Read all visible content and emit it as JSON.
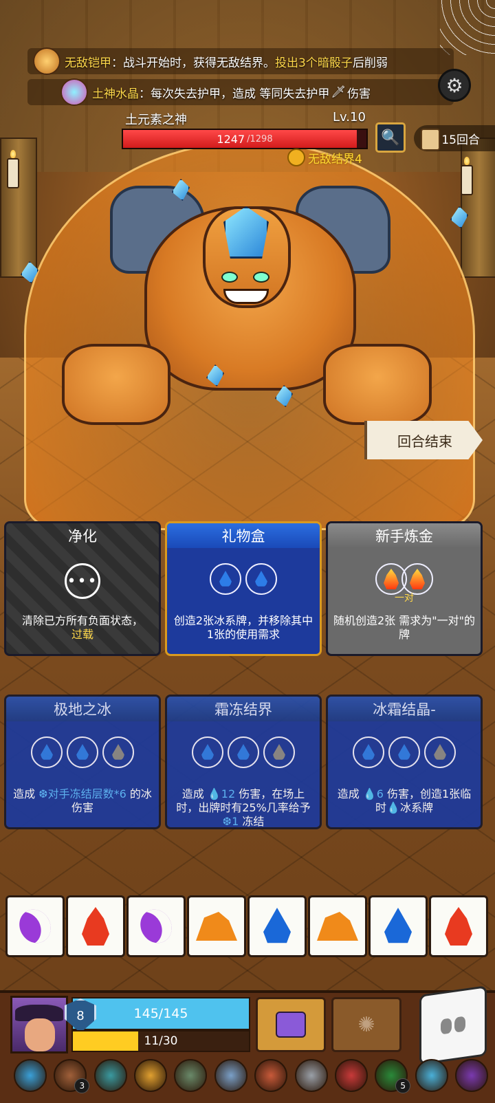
{
  "buffs": [
    {
      "name": "无敌铠甲",
      "sep": "：",
      "text_a": "战斗开始时，获得无敌结界。",
      "highlight": "投出3个暗骰子",
      "text_b": "后削弱",
      "icon": "golden-armor-icon"
    },
    {
      "name": "土神水晶",
      "sep": "：",
      "text_a": "每次失去护甲，造成 等同失去护甲",
      "highlight": "",
      "text_b": "伤害",
      "icon": "crystal-cluster-icon"
    }
  ],
  "boss": {
    "name": "土元素之神",
    "level": "Lv.10",
    "hp_current": "1247",
    "hp_max": "/1298",
    "hp_fraction": 0.96,
    "status": "无敌结界4"
  },
  "round": {
    "label": "15回合"
  },
  "end_turn": {
    "label": "回合结束"
  },
  "cards": [
    {
      "title": "净化",
      "desc_a": "清除已方所有负面状态，",
      "desc_hl": "过载",
      "requirement": "any"
    },
    {
      "title": "礼物盒",
      "desc_a": "创造2张冰系牌，并移除其中1张的使用需求",
      "requirement": "water x2"
    },
    {
      "title": "新手炼金",
      "pair_label": "一对",
      "desc_a": "随机创造2张 需求为\"一对\"的牌",
      "requirement": "fire pair"
    },
    {
      "title": "极地之冰",
      "desc_a": "造成 ",
      "desc_hl": "❆对手冻结层数*6",
      "desc_b": " 的冰伤害",
      "requirement": "water x3"
    },
    {
      "title": "霜冻结界",
      "desc_a": "造成 ",
      "desc_hl": "💧12",
      "desc_b": " 伤害，在场上时，出牌时有25%几率给予",
      "desc_hl2": "❆1",
      "desc_c": " 冻结",
      "requirement": "water x3"
    },
    {
      "title": "冰霜结晶-",
      "desc_a": "造成 ",
      "desc_hl": "💧6",
      "desc_b": " 伤害，创造1张临时",
      "desc_hl2": "💧",
      "desc_c": "冰系牌",
      "requirement": "water x3"
    }
  ],
  "dice": [
    "moon",
    "fire",
    "moon",
    "rock",
    "water",
    "rock",
    "water",
    "fire"
  ],
  "player": {
    "shield": "8",
    "hp": "145/145",
    "xp": "11/30",
    "xp_fraction": 0.37
  },
  "relics": [
    {
      "icon": "blue-mask-relic-icon",
      "count": ""
    },
    {
      "icon": "button-relic-icon",
      "count": "3"
    },
    {
      "icon": "urn-relic-icon",
      "count": ""
    },
    {
      "icon": "bird-relic-icon",
      "count": ""
    },
    {
      "icon": "scythe-relic-icon",
      "count": ""
    },
    {
      "icon": "blade-relic-icon",
      "count": ""
    },
    {
      "icon": "meat-relic-icon",
      "count": ""
    },
    {
      "icon": "dragon-relic-icon",
      "count": ""
    },
    {
      "icon": "bracelet-relic-icon",
      "count": ""
    },
    {
      "icon": "wreath-relic-icon",
      "count": "5"
    },
    {
      "icon": "horn-relic-icon",
      "count": ""
    },
    {
      "icon": "skull-book-relic-icon",
      "count": ""
    }
  ],
  "colors": {
    "hp_red": "#d21c1c",
    "player_hp": "#4fc2ee",
    "xp": "#ffcc22",
    "highlight": "#ffd84a",
    "ice_blue": "#5ab8ff"
  }
}
